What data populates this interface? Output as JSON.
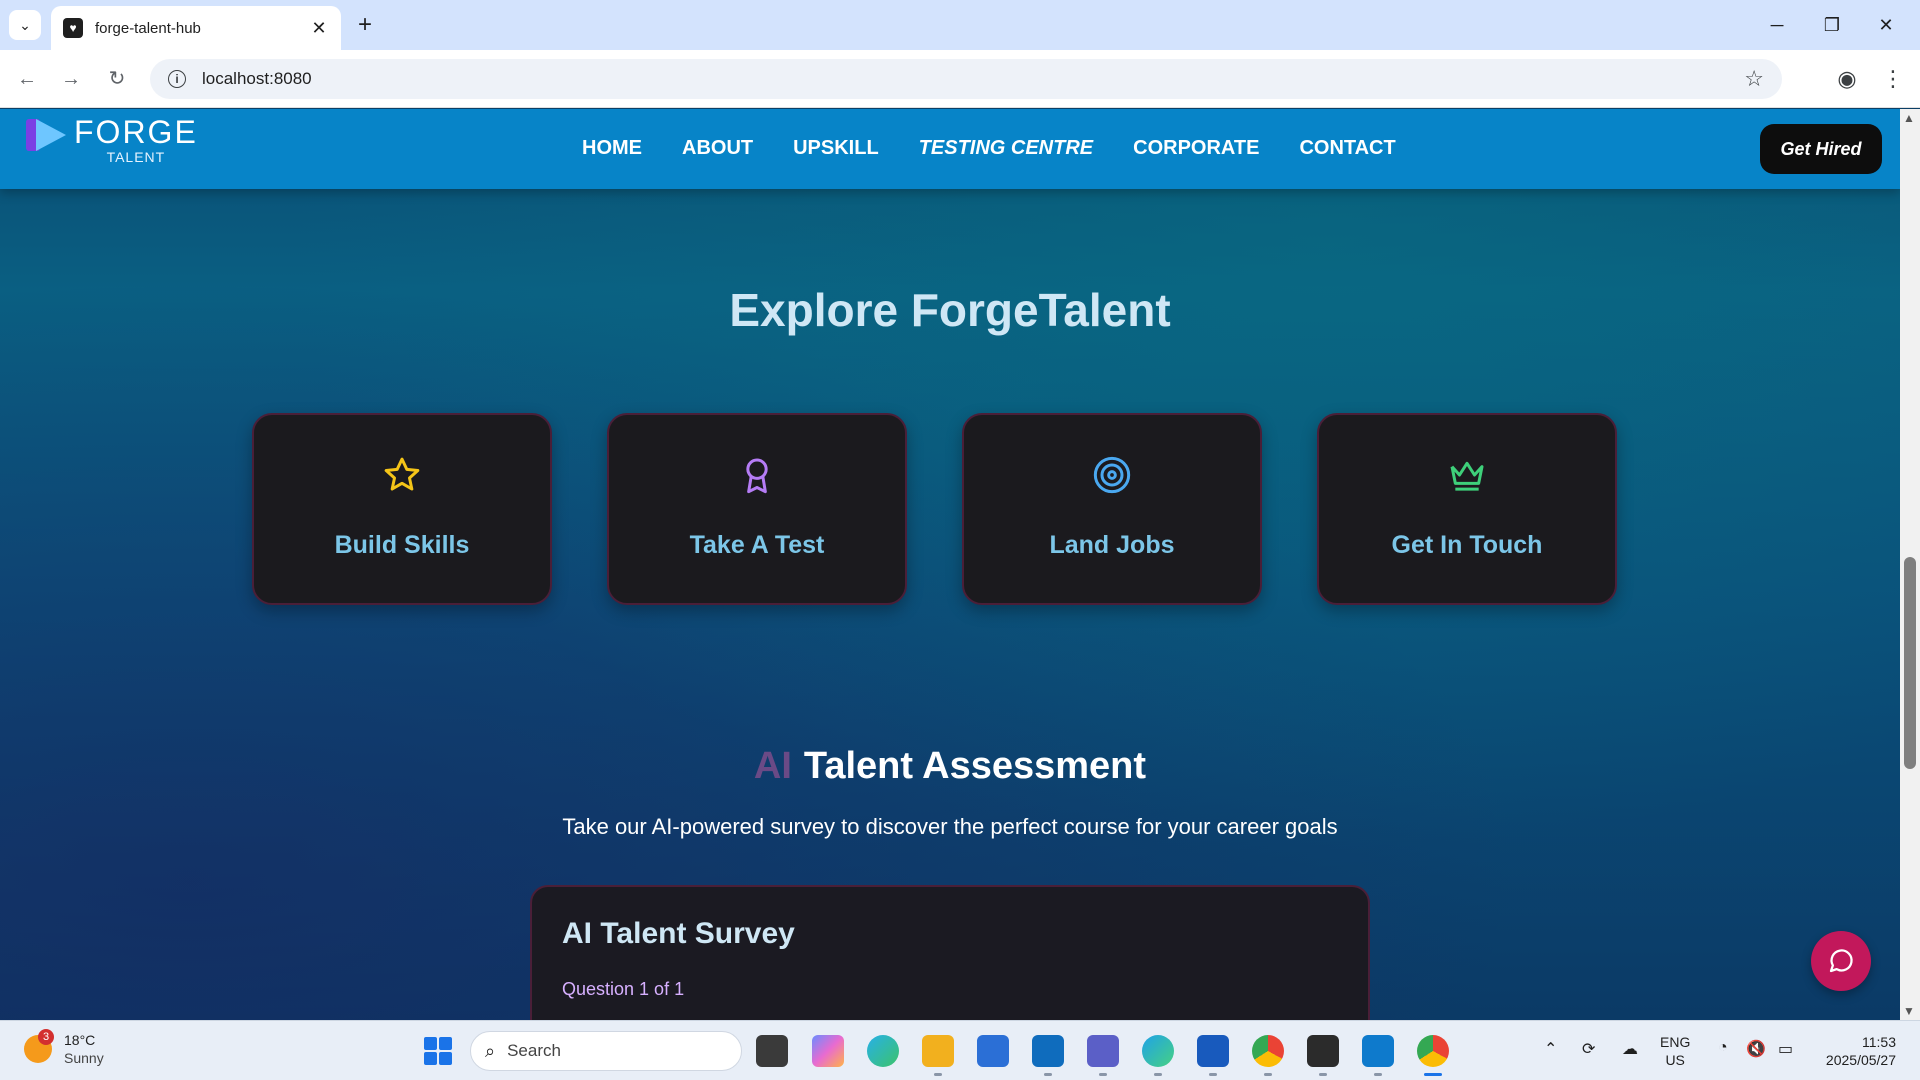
{
  "browser": {
    "tab_title": "forge-talent-hub",
    "url": "localhost:8080"
  },
  "site": {
    "logo_forge": "FORGE",
    "logo_talent": "TALENT",
    "nav": [
      {
        "label": "HOME",
        "active": false
      },
      {
        "label": "ABOUT",
        "active": false
      },
      {
        "label": "UPSKILL",
        "active": false
      },
      {
        "label": "TESTING CENTRE",
        "active": true
      },
      {
        "label": "CORPORATE",
        "active": false
      },
      {
        "label": "CONTACT",
        "active": false
      }
    ],
    "cta_label": "Get Hired"
  },
  "explore": {
    "title": "Explore ForgeTalent",
    "cards": [
      {
        "label": "Build Skills",
        "icon": "star-icon",
        "color": "#f5c518"
      },
      {
        "label": "Take A Test",
        "icon": "award-icon",
        "color": "#b57cf5"
      },
      {
        "label": "Land Jobs",
        "icon": "target-icon",
        "color": "#4aa8f0"
      },
      {
        "label": "Get In Touch",
        "icon": "crown-icon",
        "color": "#3ed07a"
      }
    ]
  },
  "assessment": {
    "ai_prefix": "AI",
    "title": "Talent Assessment",
    "subtitle": "Take our AI-powered survey to discover the perfect course for your career goals"
  },
  "survey": {
    "title": "AI Talent Survey",
    "question_counter": "Question 1 of 1"
  },
  "taskbar": {
    "weather_badge": "3",
    "temperature": "18°C",
    "condition": "Sunny",
    "search_placeholder": "Search",
    "lang_primary": "ENG",
    "lang_region": "US",
    "time": "11:53",
    "date": "2025/05/27"
  },
  "colors": {
    "nav_bar": "#0784c8",
    "card_bg": "#1b1a1e",
    "card_label": "#7cc6e8",
    "chat_button": "#c2185b"
  }
}
